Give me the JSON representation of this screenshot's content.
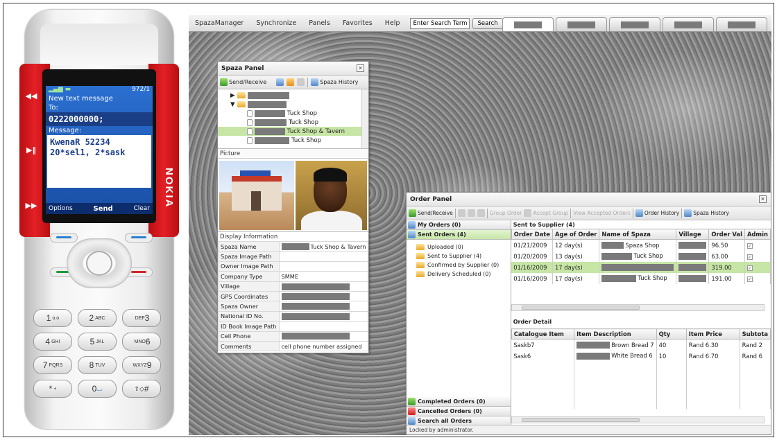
{
  "phone": {
    "status": "972/1",
    "screen_title": "New text message",
    "to_label": "To:",
    "number": "0222000000;",
    "message_label": "Message:",
    "message_line1": "KwenaR 52234",
    "message_line2": "20*sel1, 2*sask",
    "soft_left": "Options",
    "soft_mid": "Send",
    "soft_right": "Clear",
    "brand": "NOKIA",
    "keys": [
      {
        "main": "1",
        "sub": "o.o"
      },
      {
        "main": "2",
        "sub": "ABC"
      },
      {
        "main": "3",
        "sub": "DEF"
      },
      {
        "main": "4",
        "sub": "GHI"
      },
      {
        "main": "5",
        "sub": "JKL"
      },
      {
        "main": "6",
        "sub": "MNO"
      },
      {
        "main": "7",
        "sub": "PQRS"
      },
      {
        "main": "8",
        "sub": "TUV"
      },
      {
        "main": "9",
        "sub": "WXYZ"
      },
      {
        "main": "*",
        "sub": "+"
      },
      {
        "main": "0",
        "sub": ""
      },
      {
        "main": "#",
        "sub": ""
      }
    ]
  },
  "menubar": {
    "items": [
      "SpazaManager",
      "Synchronize",
      "Panels",
      "Favorites",
      "Help"
    ],
    "search_value": "Enter Search Term",
    "search_button": "Search"
  },
  "spaza_panel": {
    "title": "Spaza Panel",
    "toolbar": {
      "send_receive": "Send/Receive",
      "history": "Spaza History"
    },
    "tree": [
      "Tuck Shop",
      "Tuck Shop",
      "Tuck Shop & Tavern",
      "Tuck Shop"
    ],
    "picture_label": "Picture",
    "display_info_label": "Display Information",
    "props": [
      {
        "k": "Spaza Name",
        "v": "Tuck Shop & Tavern"
      },
      {
        "k": "Spaza Image Path",
        "v": ""
      },
      {
        "k": "Owner Image Path",
        "v": ""
      },
      {
        "k": "Company Type",
        "v": "SMME"
      },
      {
        "k": "Village",
        "v": ""
      },
      {
        "k": "GPS Coordinates",
        "v": ""
      },
      {
        "k": "Spaza Owner",
        "v": ""
      },
      {
        "k": "National ID No.",
        "v": ""
      },
      {
        "k": "ID Book Image Path",
        "v": ""
      },
      {
        "k": "Cell Phone",
        "v": ""
      },
      {
        "k": "Comments",
        "v": "cell phone number assigned"
      }
    ]
  },
  "order_panel": {
    "title": "Order Panel",
    "toolbar": {
      "send_receive": "Send/Receive",
      "group_order": "Group Order",
      "accept_group": "Accept Group",
      "view_accepted": "View Accepted Orders",
      "order_history": "Order History",
      "spaza_history": "Spaza History"
    },
    "nav": {
      "my_orders": "My Orders (0)",
      "sent_orders": "Sent Orders (4)",
      "subs": [
        "Uploaded (0)",
        "Sent to Supplier (4)",
        "Confirmed by Supplier (0)",
        "Delivery Scheduled (0)"
      ],
      "completed": "Completed Orders (0)",
      "cancelled": "Cancelled Orders (0)",
      "search_all": "Search all Orders"
    },
    "orders_label": "Sent to Supplier (4)",
    "orders_cols": [
      "Order Date",
      "Age of Order",
      "Name of Spaza",
      "Village",
      "Order Val",
      "Admin"
    ],
    "orders": [
      {
        "date": "01/21/2009",
        "age": "12 day(s)",
        "name": "Spaza Shop",
        "value": "96.50"
      },
      {
        "date": "01/20/2009",
        "age": "13 day(s)",
        "name": "Tuck Shop",
        "value": "63.00"
      },
      {
        "date": "01/16/2009",
        "age": "17 day(s)",
        "name": "",
        "value": "319.00"
      },
      {
        "date": "01/16/2009",
        "age": "17 day(s)",
        "name": "Tuck Shop",
        "value": "191.00"
      }
    ],
    "detail_label": "Order Detail",
    "detail_cols": [
      "Catalogue Item",
      "Item Description",
      "Qty",
      "Item Price",
      "Subtota"
    ],
    "details": [
      {
        "item": "Saskb7",
        "desc": "Brown Bread 7",
        "qty": "40",
        "price": "Rand 6.30",
        "sub": "Rand 2"
      },
      {
        "item": "Sask6",
        "desc": "White Bread 6",
        "qty": "10",
        "price": "Rand 6.70",
        "sub": "Rand 6"
      }
    ],
    "status": "Locked by administrator."
  }
}
